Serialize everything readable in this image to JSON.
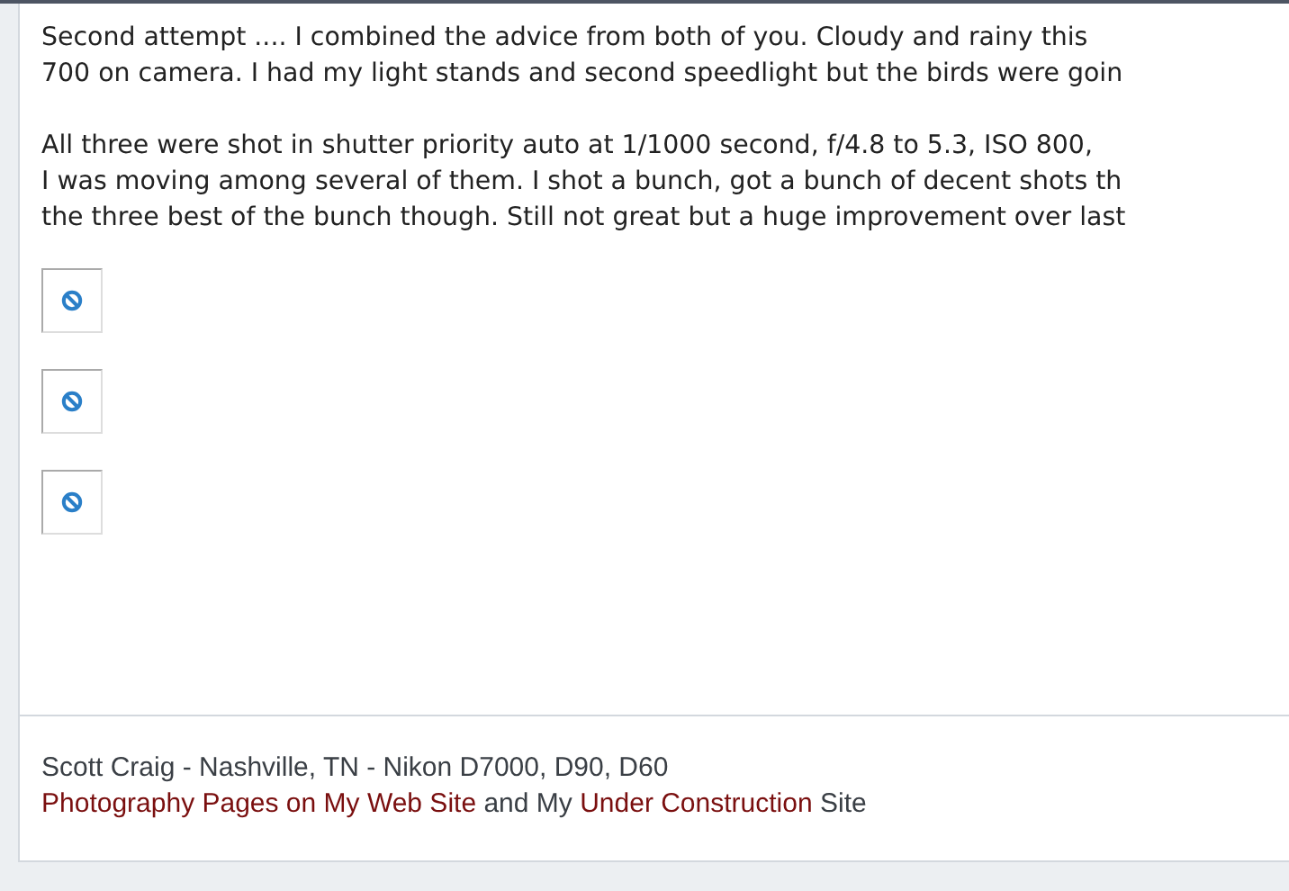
{
  "post": {
    "paragraphs": [
      [
        "Second attempt .... I combined the advice from both of you. Cloudy and rainy this",
        "700 on camera. I had my light stands and second speedlight but the birds were goin"
      ],
      [
        "All three were shot in shutter priority auto at 1/1000 second, f/4.8 to 5.3, ISO 800,",
        "I was moving among several of them. I shot a bunch, got a bunch of decent shots th",
        "the three best of the bunch though. Still not great but a huge improvement over last"
      ]
    ],
    "images": [
      {
        "kind": "broken-image"
      },
      {
        "kind": "broken-image"
      },
      {
        "kind": "broken-image"
      }
    ]
  },
  "signature": {
    "line": "Scott Craig - Nashville, TN - Nikon D7000, D90, D60",
    "parts": [
      {
        "kind": "link",
        "text": "Photography Pages on My Web Site"
      },
      {
        "kind": "text",
        "text": "and My"
      },
      {
        "kind": "link",
        "text": "Under Construction"
      },
      {
        "kind": "text",
        "text": "Site"
      }
    ]
  }
}
